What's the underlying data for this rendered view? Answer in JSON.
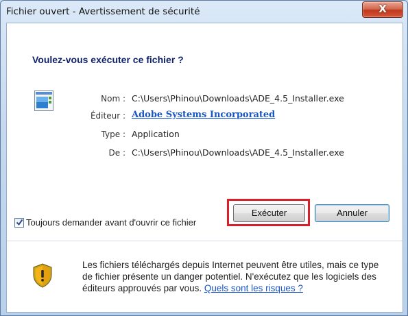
{
  "window": {
    "title": "Fichier ouvert - Avertissement de sécurité",
    "close_label": "X"
  },
  "dialog": {
    "heading": "Voulez-vous exécuter ce fichier ?",
    "fields": {
      "name_label": "Nom :",
      "name_value": "C:\\Users\\Phinou\\Downloads\\ADE_4.5_Installer.exe",
      "publisher_label": "Éditeur :",
      "publisher_value": "Adobe Systems Incorporated",
      "type_label": "Type :",
      "type_value": "Application",
      "from_label": "De :",
      "from_value": "C:\\Users\\Phinou\\Downloads\\ADE_4.5_Installer.exe"
    },
    "buttons": {
      "run": "Exécuter",
      "cancel": "Annuler"
    },
    "checkbox": {
      "label": "Toujours demander avant d'ouvrir ce fichier",
      "checked": true
    },
    "warning": {
      "text": "Les fichiers téléchargés depuis Internet peuvent être utiles, mais ce type de fichier présente un danger potentiel. N'exécutez que les logiciels des éditeurs approuvés par vous. ",
      "link": "Quels sont les risques ?"
    }
  },
  "icons": [
    "application-icon",
    "security-shield-icon",
    "close-icon",
    "checkmark-icon"
  ],
  "colors": {
    "highlight": "#d8202a",
    "link": "#1a55c4",
    "heading": "#10226b"
  }
}
